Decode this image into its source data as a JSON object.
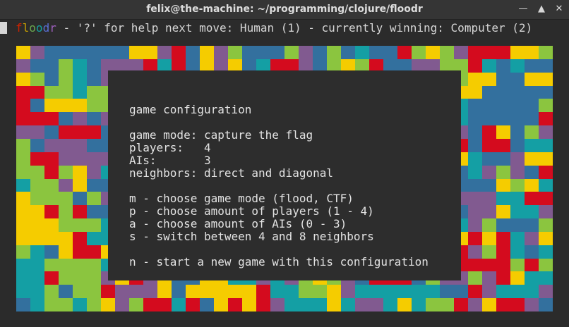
{
  "window": {
    "title": "felix@the-machine: ~/programming/clojure/floodr",
    "min_icon": "minimize-icon",
    "max_icon": "maximize-icon",
    "close_icon": "close-icon"
  },
  "status": {
    "app_name": "floodr",
    "app_name_colors": [
      "#cc2200",
      "#c8a000",
      "#6aa84f",
      "#14a0a0",
      "#5a6fd6",
      "#a060c0"
    ],
    "text": " - '?' for help next move: Human (1) - currently winning: Computer (2)"
  },
  "board": {
    "palette": [
      "#d40b1e",
      "#f5cc00",
      "#8bc53f",
      "#149fa4",
      "#33709e",
      "#815a90"
    ]
  },
  "config": {
    "heading": "game configuration",
    "game_mode_line": "game mode: capture the flag",
    "players_line": "players:   4",
    "ais_line": "AIs:       3",
    "neighbors_line": "neighbors: direct and diagonal",
    "help": [
      "m - choose game mode (flood, CTF)",
      "p - choose amount of players (1 - 4)",
      "a - choose amount of AIs (0 - 3)",
      "s - switch between 4 and 8 neighbors"
    ],
    "start_line": "n - start a new game with this configuration"
  }
}
